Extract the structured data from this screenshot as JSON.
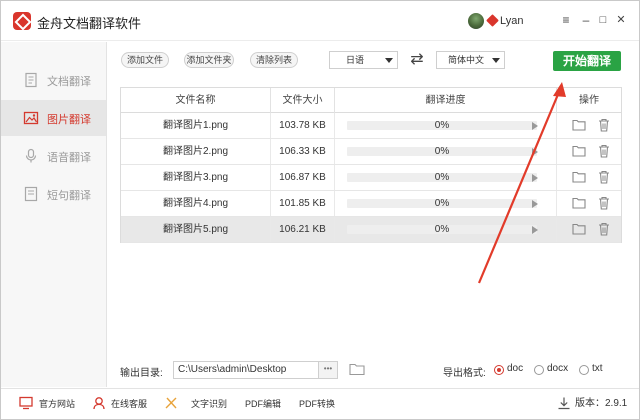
{
  "app": {
    "title": "金舟文档翻译软件",
    "username": "Lyan"
  },
  "window": {
    "minimize": "–",
    "maximize": "□",
    "close": "✕",
    "menu": "≡"
  },
  "sidebar": {
    "items": [
      {
        "label": "文档翻译",
        "icon": "document-icon",
        "active": false
      },
      {
        "label": "图片翻译",
        "icon": "image-icon",
        "active": true
      },
      {
        "label": "语音翻译",
        "icon": "microphone-icon",
        "active": false
      },
      {
        "label": "短句翻译",
        "icon": "phrase-icon",
        "active": false
      }
    ]
  },
  "toolbar": {
    "add_file": "添加文件",
    "add_folder": "添加文件夹",
    "clear_list": "清除列表",
    "source_lang": "日语",
    "target_lang": "简体中文",
    "swap_icon": "⇄",
    "start": "开始翻译"
  },
  "table": {
    "headers": [
      "文件名称",
      "文件大小",
      "翻译进度",
      "操作"
    ],
    "rows": [
      {
        "name": "翻译图片1.png",
        "size": "103.78 KB",
        "progress": "0%"
      },
      {
        "name": "翻译图片2.png",
        "size": "106.33 KB",
        "progress": "0%"
      },
      {
        "name": "翻译图片3.png",
        "size": "106.87 KB",
        "progress": "0%"
      },
      {
        "name": "翻译图片4.png",
        "size": "101.85 KB",
        "progress": "0%"
      },
      {
        "name": "翻译图片5.png",
        "size": "106.21 KB",
        "progress": "0%"
      }
    ]
  },
  "output": {
    "label": "输出目录:",
    "path": "C:\\Users\\admin\\Desktop",
    "dots": "•••"
  },
  "format": {
    "label": "导出格式:",
    "options": [
      "doc",
      "docx",
      "txt"
    ],
    "selected": "doc"
  },
  "footer": {
    "items": [
      "官方网站",
      "在线客服",
      "文字识别",
      "PDF编辑",
      "PDF转换"
    ],
    "version": "版本：2.9.1"
  },
  "colors": {
    "accent": "#d43a2f",
    "start_button": "#2aa344",
    "annotation_arrow": "#e23b2a"
  }
}
